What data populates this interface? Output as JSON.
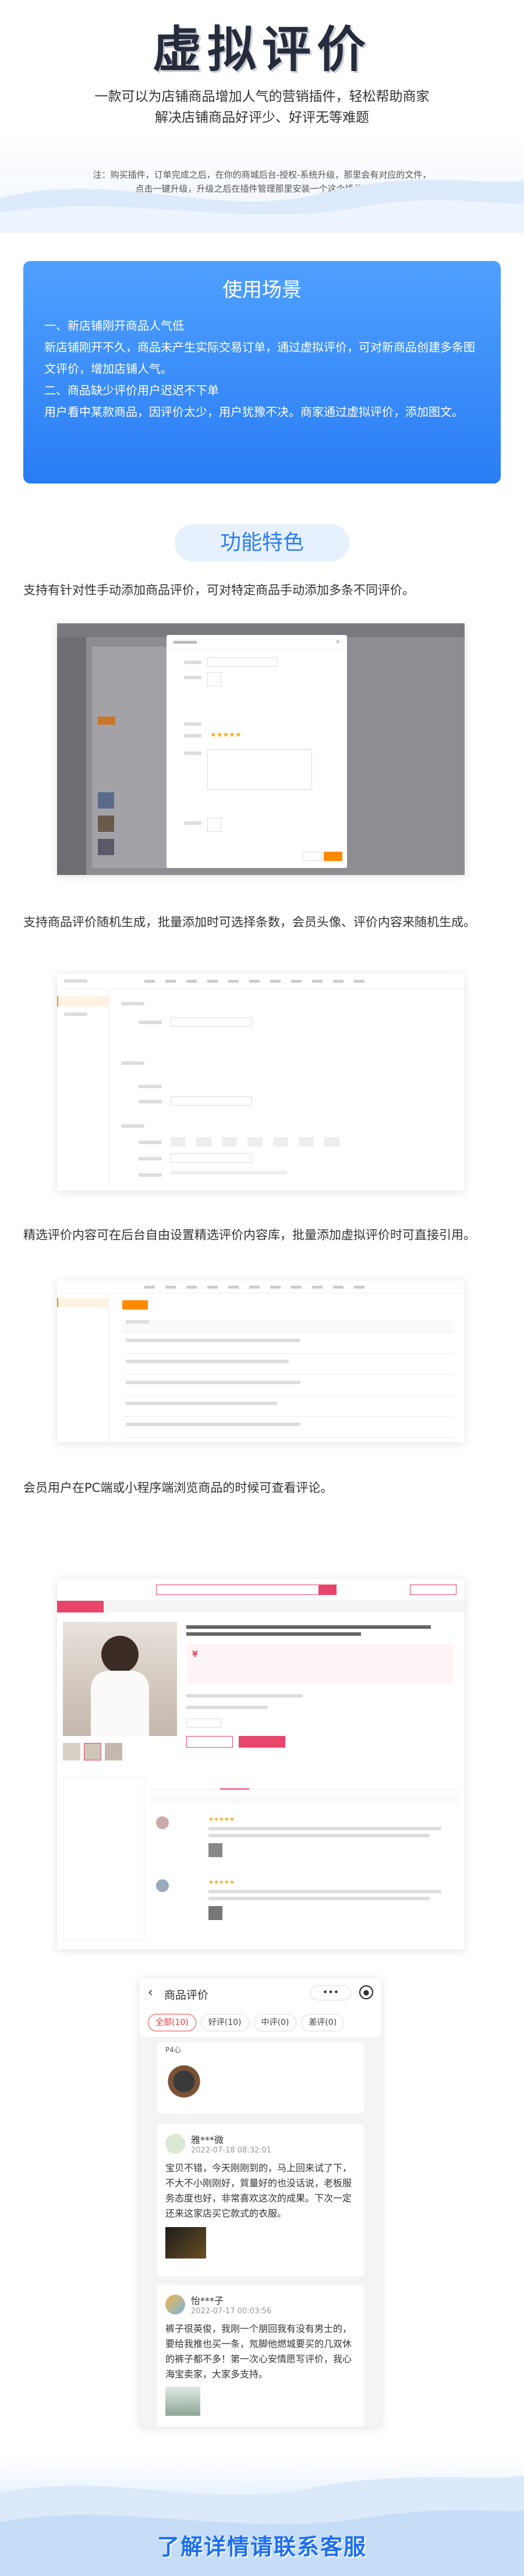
{
  "hero": {
    "title": "虚拟评价",
    "subtitle_line1": "一款可以为店铺商品增加人气的营销插件，轻松帮助商家",
    "subtitle_line2": "解决店铺商品好评少、好评无等难题",
    "note_line1": "注：购买插件，订单完成之后，在你的商城后台-授权-系统升级，那里会有对应的文件，",
    "note_line2": "点击一键升级，升级之后在插件管理那里安装一个这个插件即可。"
  },
  "usage": {
    "title": "使用场景",
    "item1_title": "一、新店铺刚开商品人气低",
    "item1_text": "新店铺刚开不久，商品未产生实际交易订单，通过虚拟评价，可对新商品创建多条图文评价，增加店铺人气。",
    "item2_title": "二、商品缺少评价用户迟迟不下单",
    "item2_text": "用户看中某款商品，因评价太少，用户犹豫不决。商家通过虚拟评价，添加图文。"
  },
  "features": {
    "title": "功能特色",
    "p1": "支持有针对性手动添加商品评价，可对特定商品手动添加多条不同评价。",
    "p2": "支持商品评价随机生成，批量添加时可选择条数，会员头像、评价内容来随机生成。",
    "p3": "精选评价内容可在后台自由设置精选评价内容库，批量添加虚拟评价时可直接引用。",
    "p4": "会员用户在PC端或小程序端浏览商品的时候可查看评论。"
  },
  "mobile": {
    "back_icon": "chevron-left-icon",
    "title": "商品评价",
    "more_icon": "ellipsis-icon",
    "target_icon": "target-icon",
    "tabs": [
      "全部(10)",
      "好评(10)",
      "中评(0)",
      "差评(0)"
    ],
    "top_text": "P4心",
    "review1": {
      "name": "雅***微",
      "date": "2022-07-18 08:32:01",
      "text": "宝贝不错，今天刚刚到的，马上回来试了下，不大不小刚刚好，質量好的也没话说，老板服务态度也好，非常喜欢这次的成果。下次一定还来这家店买它款式的衣服。"
    },
    "review2": {
      "name": "怡***子",
      "date": "2022-07-17 00:03:56",
      "text": "裤子很英俊，我刚一个朋回我有没有男士的，要给我推也买一条，氖脚他燃城要买的几双休的裤子都不多！第一次心安情愿写评价，我心海宝卖家，大家多支持。"
    }
  },
  "footer": {
    "text": "了解详情请联系客服"
  }
}
